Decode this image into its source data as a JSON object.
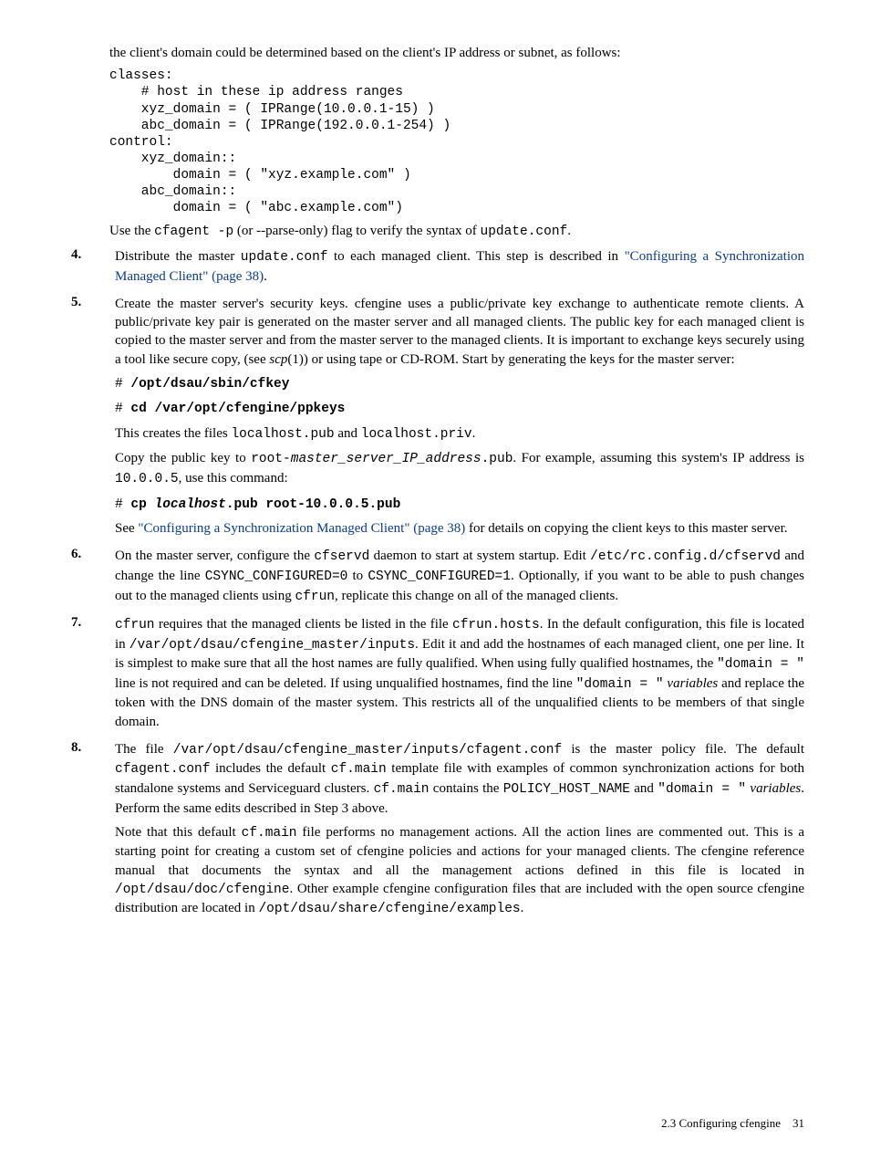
{
  "intro": {
    "p1": "the client's domain could be determined based on the client's IP address or subnet, as follows:"
  },
  "codeblock1": "classes:\n    # host in these ip address ranges\n    xyz_domain = ( IPRange(10.0.0.1-15) )\n    abc_domain = ( IPRange(192.0.0.1-254) )\ncontrol:\n    xyz_domain::\n        domain = ( \"xyz.example.com\" )\n    abc_domain::\n        domain = ( \"abc.example.com\")",
  "after_code1": {
    "prefix": "Use the ",
    "cfagent": "cfagent -p",
    "mid": " (or --parse-only) flag to verify the syntax of ",
    "updateconf": "update.conf",
    "suffix": "."
  },
  "step4": {
    "num": "4.",
    "prefix": "Distribute the master ",
    "updateconf": "update.conf",
    "mid": " to each managed client. This step is described in ",
    "link": "\"Configuring a Synchronization Managed Client\" (page 38)",
    "suffix": "."
  },
  "step5": {
    "num": "5.",
    "p1_a": "Create the master server's security keys. cfengine uses a public/private key exchange to authenticate remote clients. A public/private key pair is generated on the master server and all managed clients. The public key for each managed client is copied to the master server and from the master server to the managed clients. It is important to exchange keys securely using a tool like secure copy, (see ",
    "scp": "scp",
    "p1_b": "(1)) or using tape or CD-ROM. Start by generating the keys for the master server:",
    "cmd1_prefix": "# ",
    "cmd1": "/opt/dsau/sbin/cfkey",
    "cmd2_prefix": "# ",
    "cmd2": "cd /var/opt/cfengine/ppkeys",
    "p2_a": "This creates the files ",
    "localhostpub": "localhost.pub",
    "p2_b": " and ",
    "localhostpriv": "localhost.priv",
    "p2_c": ".",
    "p3_a": "Copy the public key to ",
    "root_ms": "root-",
    "root_ms_i": "master_server_IP_address",
    "root_ms_end": ".pub",
    "p3_b": ". For example, assuming this system's IP address is ",
    "ip": "10.0.0.5",
    "p3_c": ", use this command:",
    "cmd3_prefix": "# ",
    "cmd3_a": "cp ",
    "cmd3_b": "localhost",
    "cmd3_c": ".pub root-10.0.0.5.pub",
    "p4_a": "See ",
    "link": "\"Configuring a Synchronization Managed Client\" (page 38)",
    "p4_b": " for details on copying the client keys to this master server."
  },
  "step6": {
    "num": "6.",
    "a": "On the master server, configure the ",
    "cfservd": "cfservd",
    "b": " daemon to start at system startup. Edit ",
    "etc": "/etc/",
    "rc": "rc.config.d/cfservd",
    "c": " and change the line ",
    "csync0": "CSYNC_CONFIGURED=0",
    "d": " to ",
    "csync1": "CSYNC_CONFIGURED=1",
    "e": ". Optionally, if you want to be able to push changes out to the managed clients using ",
    "cfrun": "cfrun",
    "f": ", replicate this change on all of the managed clients."
  },
  "step7": {
    "num": "7.",
    "a": "",
    "cfrun": "cfrun",
    "b": " requires that the managed clients be listed in the file ",
    "hosts": "cfrun.hosts",
    "c": ". In the default configuration, this file is located in ",
    "inputs": "/var/opt/dsau/cfengine_master/inputs",
    "d": ". Edit it and add the hostnames of each managed client, one per line. It is simplest to make sure that all the host names are fully qualified. When using fully qualified hostnames, the ",
    "domain1": "\"domain = \"",
    "e": " line is not required and can be deleted. If using unqualified hostnames, find the line ",
    "domain2": "\"domain = \"",
    "f": " ",
    "vars": "variables",
    "g": " and replace the token with the DNS domain of the master system. This restricts all of the unqualified clients to be members of that single domain."
  },
  "step8": {
    "num": "8.",
    "a": "The file ",
    "path": "/var/opt/dsau/cfengine_master/inputs/cfagent.conf",
    "b": " is the master policy file. The default ",
    "cfagent": "cfagent.conf",
    "c": " includes the default ",
    "cfmain1": "cf.main",
    "d": " template file with examples of common synchronization actions for both standalone systems and Serviceguard clusters. ",
    "cfmain2": "cf.main",
    "e": " contains the ",
    "phn": "POLICY_HOST_NAME",
    "f": " and ",
    "domain": "\"domain = \"",
    "g": " ",
    "vars": "variables",
    "h": ". Perform the same edits described in Step 3 above.",
    "p2_a": "Note that this default ",
    "cfmain3": "cf.main",
    "p2_b": " file performs no management actions. All the action lines are commented out. This is a starting point for creating a custom set of cfengine policies and actions for your managed clients. The cfengine reference manual that documents the syntax and all the management actions defined in this file is located in ",
    "doc": "/opt/dsau/doc/cfengine",
    "p2_c": ". Other example cfengine configuration files that are included with the open source cfengine distribution are located in ",
    "examples": "/opt/dsau/share/cfengine/examples",
    "p2_d": "."
  },
  "footer": {
    "section": "2.3 Configuring cfengine",
    "page": "31"
  }
}
